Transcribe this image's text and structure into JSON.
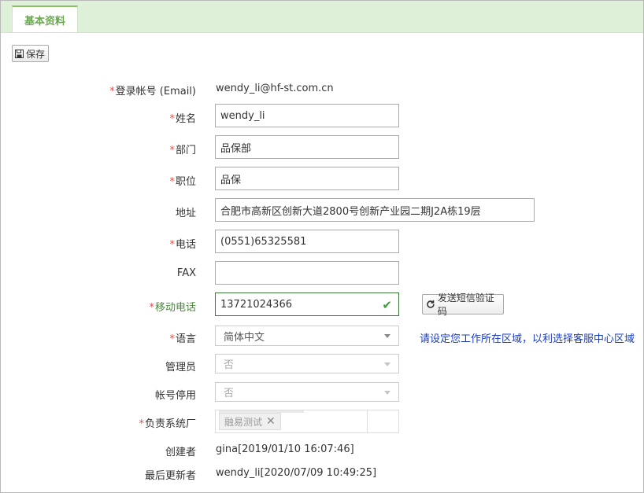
{
  "tab": {
    "label": "基本资料"
  },
  "toolbar": {
    "save_label": "保存",
    "save_icon": "floppy-icon"
  },
  "fields": {
    "email": {
      "label": "登录帐号 (Email)",
      "value": "wendy_li@hf-st.com.cn"
    },
    "name": {
      "label": "姓名",
      "value": "wendy_li"
    },
    "dept": {
      "label": "部门",
      "value": "品保部"
    },
    "position": {
      "label": "职位",
      "value": "品保"
    },
    "address": {
      "label": "地址",
      "value": "合肥市高新区创新大道2800号创新产业园二期J2A栋19层"
    },
    "phone": {
      "label": "电话",
      "value": "(0551)65325581"
    },
    "fax": {
      "label": "FAX",
      "value": ""
    },
    "mobile": {
      "label": "移动电话",
      "value": "13721024366",
      "sms_button": "发送短信验证码"
    },
    "language": {
      "label": "语言",
      "value": "简体中文",
      "hint": "请设定您工作所在区域，以利选择客服中心区域"
    },
    "admin": {
      "label": "管理员",
      "value": "否"
    },
    "disabled": {
      "label": "帐号停用",
      "value": "否"
    },
    "vendor": {
      "label": "负责系统厂",
      "chip": "融易测试"
    },
    "creator": {
      "label": "创建者",
      "value": "gina[2019/01/10 16:07:46]"
    },
    "updater": {
      "label": "最后更新者",
      "value": "wendy_li[2020/07/09 10:49:25]"
    }
  },
  "colors": {
    "accent": "#8bbd67",
    "tab_bg": "#dff0d8",
    "required": "#d9534f",
    "hint": "#1a3cc2",
    "valid": "#3c763d"
  }
}
